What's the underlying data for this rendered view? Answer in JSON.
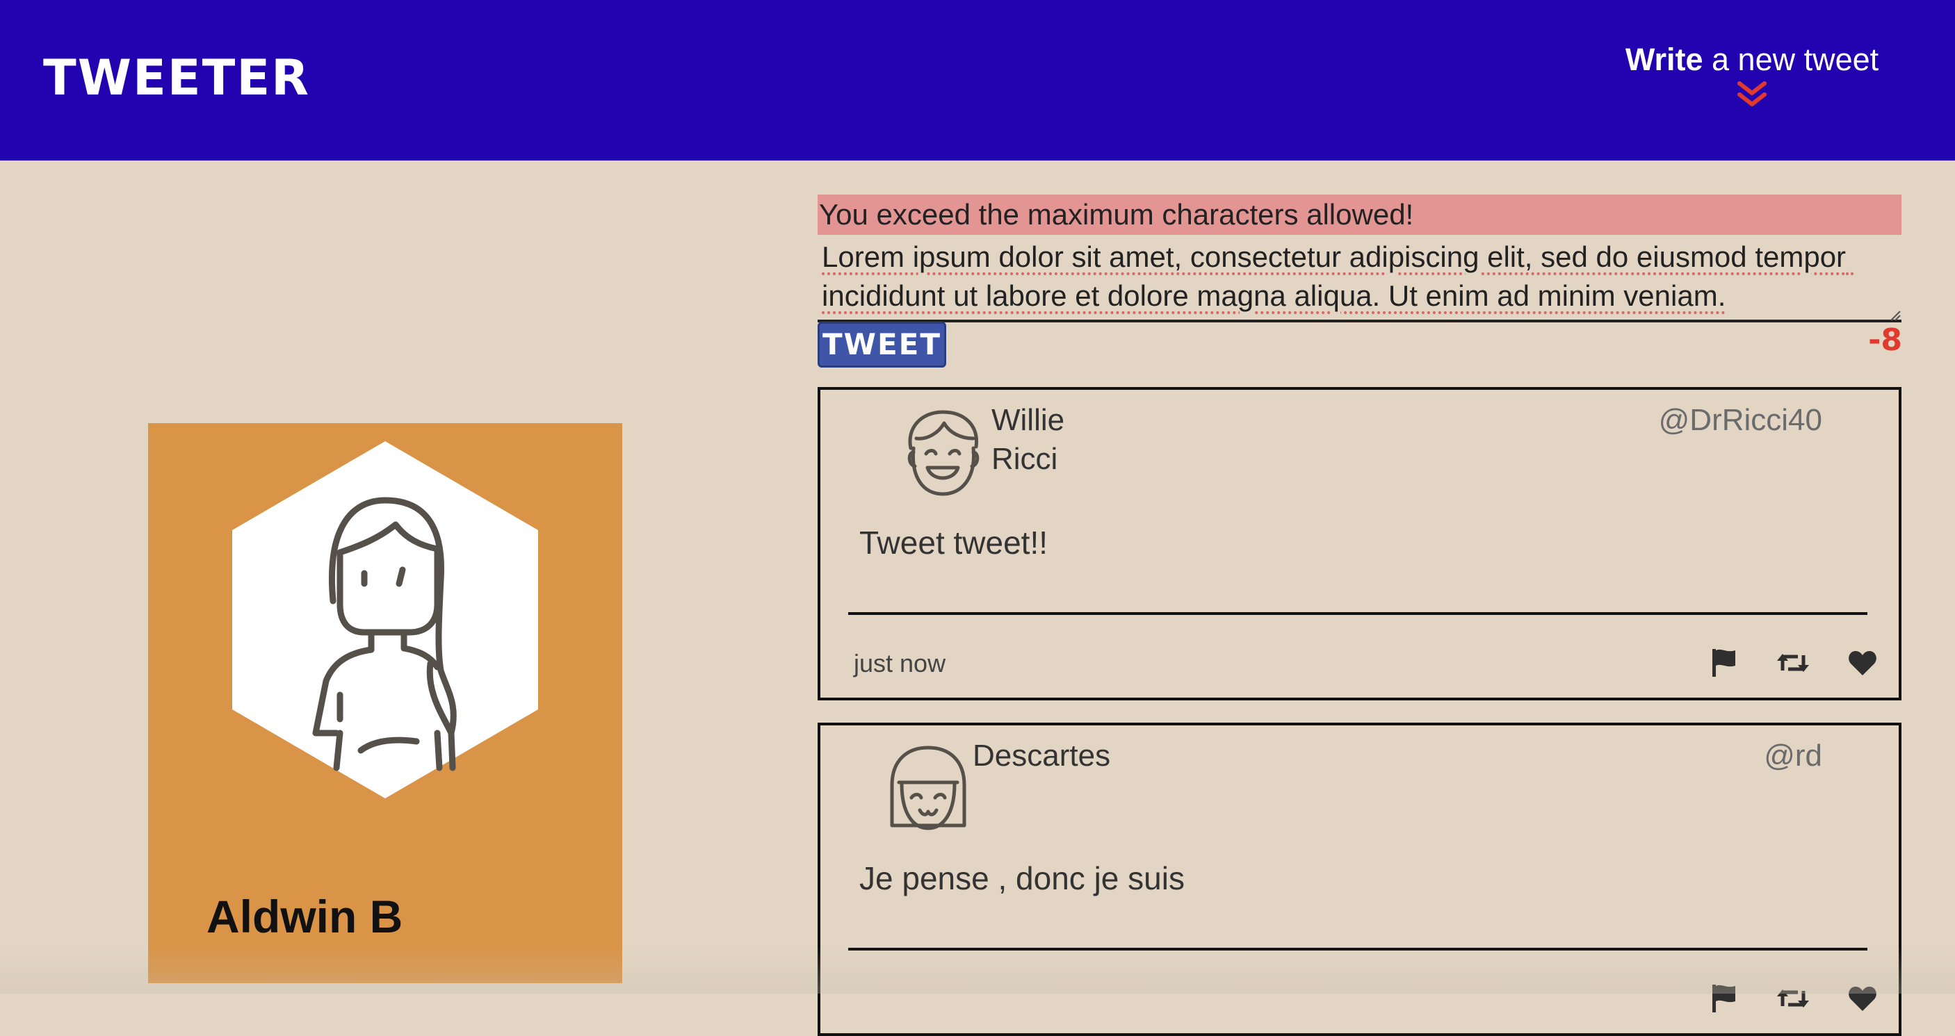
{
  "nav": {
    "logo": "TWEETER",
    "write_bold": "Write",
    "write_rest": " a new tweet",
    "chevron_icon": "double-chevron-down-icon",
    "chevron_color": "#e03a2f"
  },
  "profile": {
    "name": "Aldwin B",
    "card_color": "#d99447",
    "avatar_icon": "woman-avatar-icon"
  },
  "compose": {
    "error": "You exceed the maximum characters allowed!",
    "text": "Lorem ipsum dolor sit amet, consectetur adipiscing elit, sed do eiusmod tempor incididunt ut labore et dolore magna aliqua. Ut enim ad minim veniam.",
    "button_label": "TWEET",
    "counter": "-8",
    "counter_color": "#e03a2f"
  },
  "tweets": [
    {
      "name": "Willie Ricci",
      "handle": "@DrRicci40",
      "body": "Tweet tweet!!",
      "time": "just now",
      "avatar_icon": "laughing-boy-avatar-icon"
    },
    {
      "name": "Descartes",
      "handle": "@rd",
      "body": "Je pense , donc je suis",
      "time": "",
      "avatar_icon": "smiling-girl-avatar-icon"
    }
  ],
  "actions": {
    "flag_icon": "flag-icon",
    "retweet_icon": "retweet-icon",
    "like_icon": "heart-icon"
  }
}
